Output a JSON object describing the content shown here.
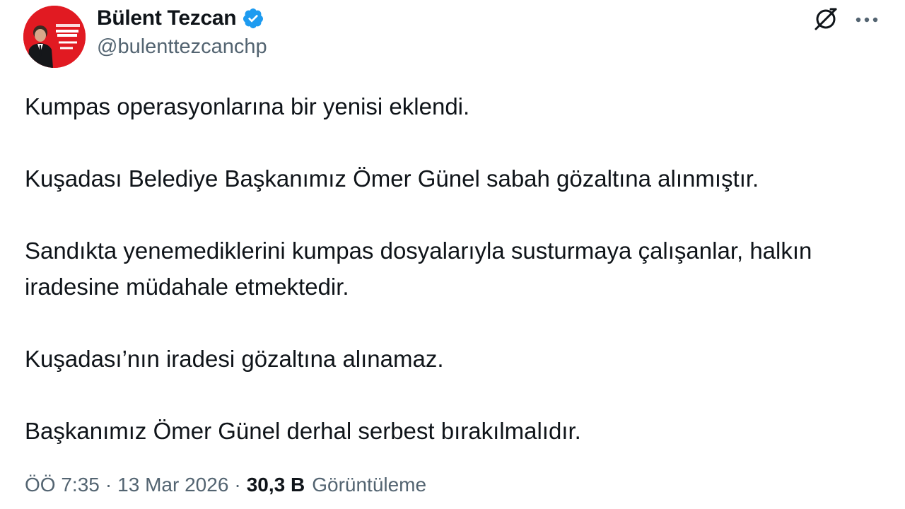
{
  "author": {
    "name": "Bülent Tezcan",
    "handle": "@bulenttezcanchp",
    "verified_color": "#1d9bf0",
    "avatar_color": "#e11a22"
  },
  "tweet": {
    "paragraphs": [
      "Kumpas operasyonlarına bir yenisi eklendi.",
      "Kuşadası Belediye Başkanımız Ömer Günel sabah gözaltına alınmıştır.",
      "Sandıkta yenemediklerini kumpas dosyalarıyla susturmaya çalışanlar, halkın iradesine müdahale etmektedir.",
      "Kuşadası’nın iradesi gözaltına alınamaz.",
      "Başkanımız Ömer Günel derhal serbest bırakılmalıdır."
    ]
  },
  "meta": {
    "time": "ÖÖ 7:35",
    "separator": "·",
    "date": "13 Mar 2026",
    "views_count": "30,3 B",
    "views_label": "Görüntüleme"
  },
  "icons": {
    "verified": "verified-badge-icon",
    "grok": "grok-icon",
    "more": "more-options-icon"
  }
}
